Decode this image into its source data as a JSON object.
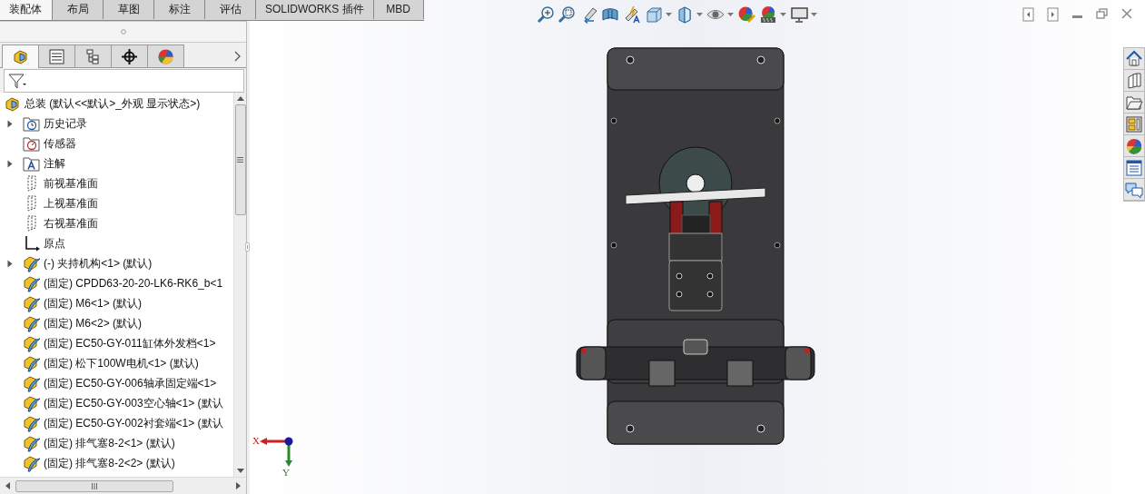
{
  "command_tabs": [
    {
      "label": "装配体",
      "selected": true
    },
    {
      "label": "布局",
      "selected": false
    },
    {
      "label": "草图",
      "selected": false
    },
    {
      "label": "标注",
      "selected": false
    },
    {
      "label": "评估",
      "selected": false
    },
    {
      "label": "SOLIDWORKS 插件",
      "selected": false
    },
    {
      "label": "MBD",
      "selected": false
    }
  ],
  "panel_tabs": [
    {
      "selected": true
    },
    {
      "selected": false
    },
    {
      "selected": false
    },
    {
      "selected": false
    },
    {
      "selected": false
    }
  ],
  "tree": {
    "root": "总装  (默认<<默认>_外观 显示状态>)",
    "items": [
      {
        "label": "历史记录",
        "kind": "history",
        "expandable": true
      },
      {
        "label": "传感器",
        "kind": "sensor",
        "expandable": false
      },
      {
        "label": "注解",
        "kind": "annotation",
        "expandable": true
      },
      {
        "label": "前视基准面",
        "kind": "plane",
        "expandable": false
      },
      {
        "label": "上视基准面",
        "kind": "plane",
        "expandable": false
      },
      {
        "label": "右视基准面",
        "kind": "plane",
        "expandable": false
      },
      {
        "label": "原点",
        "kind": "origin",
        "expandable": false
      },
      {
        "label": "(-) 夹持机构<1> (默认)",
        "kind": "component",
        "expandable": true
      },
      {
        "label": "(固定) CPDD63-20-20-LK6-RK6_b<1",
        "kind": "component",
        "expandable": false
      },
      {
        "label": "(固定) M6<1> (默认)",
        "kind": "component",
        "expandable": false
      },
      {
        "label": "(固定) M6<2> (默认)",
        "kind": "component",
        "expandable": false
      },
      {
        "label": "(固定) EC50-GY-011缸体外发档<1>",
        "kind": "component",
        "expandable": false
      },
      {
        "label": "(固定) 松下100W电机<1> (默认)",
        "kind": "component",
        "expandable": false
      },
      {
        "label": "(固定) EC50-GY-006轴承固定端<1>",
        "kind": "component",
        "expandable": false
      },
      {
        "label": "(固定) EC50-GY-003空心轴<1> (默认",
        "kind": "component",
        "expandable": false
      },
      {
        "label": "(固定) EC50-GY-002衬套端<1> (默认",
        "kind": "component",
        "expandable": false
      },
      {
        "label": "(固定) 排气塞8-2<1> (默认)",
        "kind": "component",
        "expandable": false
      },
      {
        "label": "(固定) 排气塞8-2<2> (默认)",
        "kind": "component",
        "expandable": false
      }
    ]
  },
  "triad": {
    "x_label": "X",
    "y_label": "Y"
  }
}
